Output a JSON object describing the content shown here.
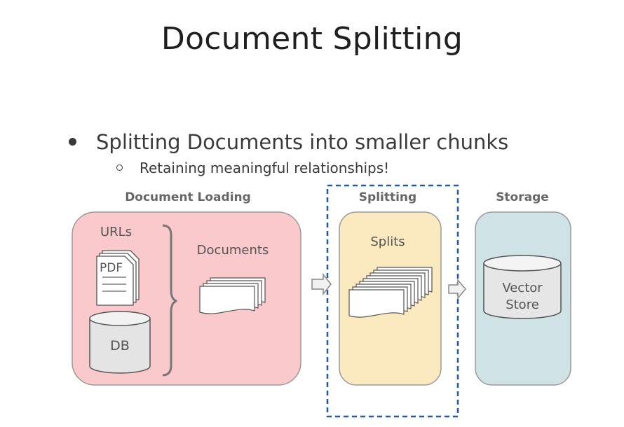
{
  "title": "Document Splitting",
  "bullets": {
    "main": "Splitting Documents into smaller chunks",
    "sub": "Retaining meaningful relationships!"
  },
  "sections": {
    "loading": "Document Loading",
    "splitting": "Splitting",
    "storage": "Storage"
  },
  "sources": {
    "urls": "URLs",
    "pdf": "PDF",
    "db": "DB"
  },
  "documents_label": "Documents",
  "splits_label": "Splits",
  "vector_store": {
    "line1": "Vector",
    "line2": "Store"
  },
  "colors": {
    "loading_fill": "#f9c9cc",
    "splitting_fill": "#fbeac0",
    "storage_fill": "#cfe3e6",
    "highlight_border": "#1f5a9a"
  }
}
